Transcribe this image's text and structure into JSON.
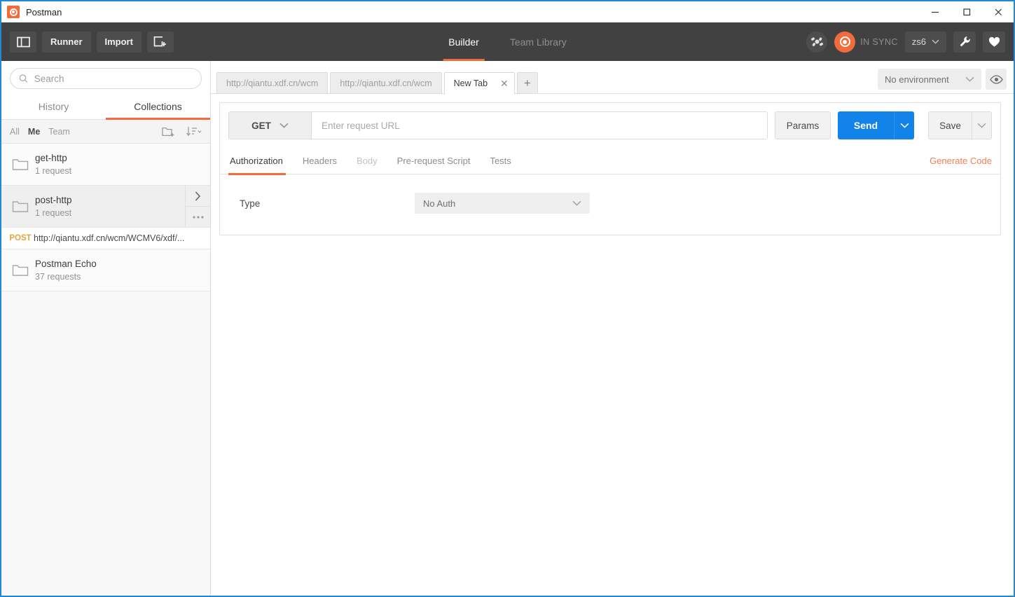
{
  "window": {
    "title": "Postman",
    "logo_icon": "postman-logo-icon",
    "minimize_icon": "minimize-icon",
    "maximize_icon": "maximize-icon",
    "close_icon": "close-icon",
    "border_color": "#1e8ad6"
  },
  "toolbar": {
    "background": "#414141",
    "sidebar_toggle_icon": "sidebar-toggle-icon",
    "runner_label": "Runner",
    "import_label": "Import",
    "new_window_icon": "new-window-icon",
    "tabs": [
      {
        "label": "Builder",
        "active": true
      },
      {
        "label": "Team Library",
        "active": false
      }
    ],
    "satellite_icon": "satellite-icon",
    "sync_icon": "sync-orb-icon",
    "sync_label": "IN SYNC",
    "user_label": "zs6",
    "user_chevron_icon": "chevron-down-icon",
    "wrench_icon": "wrench-icon",
    "heart_icon": "heart-icon",
    "accent": "#f26b3a"
  },
  "sidebar": {
    "search": {
      "placeholder": "Search",
      "value": "",
      "icon": "search-icon"
    },
    "tabs": [
      {
        "label": "History",
        "active": false
      },
      {
        "label": "Collections",
        "active": true
      }
    ],
    "filters": [
      {
        "label": "All",
        "selected": false
      },
      {
        "label": "Me",
        "selected": true
      },
      {
        "label": "Team",
        "selected": false
      }
    ],
    "new_folder_icon": "new-folder-icon",
    "sort_icon": "sort-icon",
    "items": [
      {
        "type": "collection",
        "name": "get-http",
        "count": "1 request",
        "icon": "folder-icon",
        "hovered": false
      },
      {
        "type": "collection",
        "name": "post-http",
        "count": "1 request",
        "icon": "folder-icon",
        "hovered": true,
        "expand_icon": "chevron-right-icon",
        "more_icon": "more-horizontal-icon"
      },
      {
        "type": "request",
        "method": "POST",
        "url": "http://qiantu.xdf.cn/wcm/WCMV6/xdf/...",
        "method_color": "#e8a33d"
      },
      {
        "type": "collection",
        "name": "Postman Echo",
        "count": "37 requests",
        "icon": "folder-icon",
        "hovered": false
      }
    ]
  },
  "main": {
    "request_tabs": [
      {
        "label": "http://qiantu.xdf.cn/wcm",
        "active": false,
        "closable": false
      },
      {
        "label": "http://qiantu.xdf.cn/wcm",
        "active": false,
        "closable": false
      },
      {
        "label": "New Tab",
        "active": true,
        "closable": true,
        "close_icon": "close-icon"
      }
    ],
    "add_tab_label": "+",
    "environment": {
      "value": "No environment",
      "chevron_icon": "chevron-down-icon",
      "eye_icon": "eye-icon"
    },
    "request": {
      "method": "GET",
      "method_chevron_icon": "chevron-down-icon",
      "url_value": "",
      "url_placeholder": "Enter request URL",
      "params_label": "Params",
      "send_label": "Send",
      "send_caret_icon": "chevron-down-icon",
      "send_color": "#1283e8",
      "save_label": "Save",
      "save_caret_icon": "chevron-down-icon"
    },
    "request_tabs_row": [
      {
        "label": "Authorization",
        "active": true,
        "dim": false
      },
      {
        "label": "Headers",
        "active": false,
        "dim": false
      },
      {
        "label": "Body",
        "active": false,
        "dim": true
      },
      {
        "label": "Pre-request Script",
        "active": false,
        "dim": false
      },
      {
        "label": "Tests",
        "active": false,
        "dim": false
      }
    ],
    "generate_code_label": "Generate Code",
    "generate_code_color": "#f0804f",
    "auth": {
      "type_label": "Type",
      "type_value": "No Auth",
      "type_chevron_icon": "chevron-down-icon"
    }
  }
}
